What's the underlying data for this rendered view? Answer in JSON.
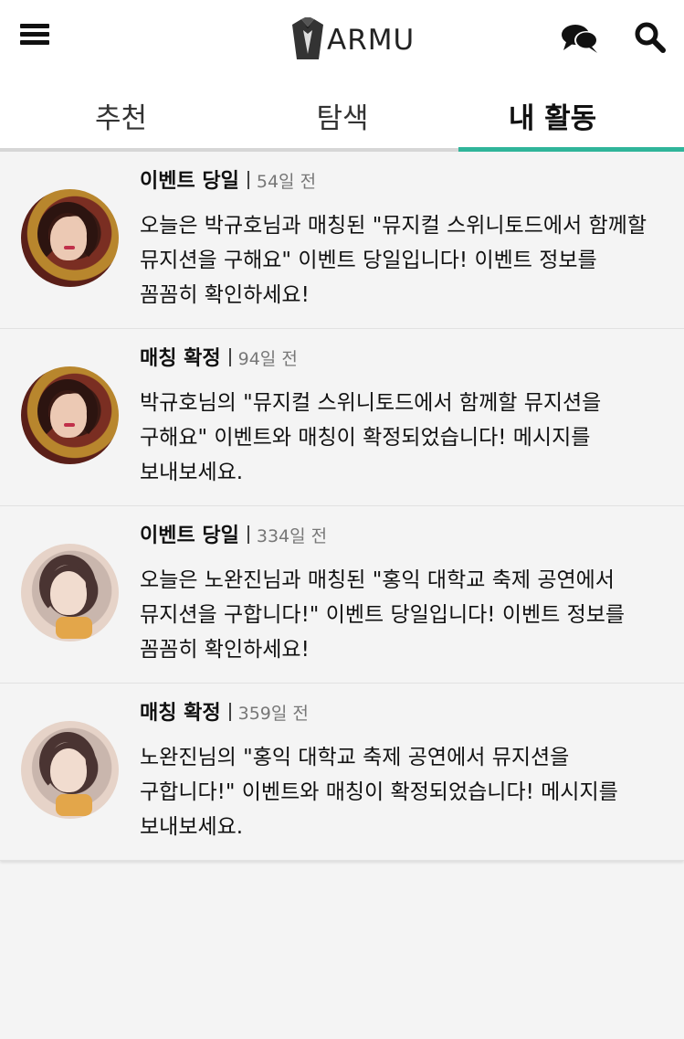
{
  "app": {
    "logo_text": "ARMU"
  },
  "icons": {
    "menu": "hamburger-menu-icon",
    "logo": "tuxedo-logo-icon",
    "chat": "chat-bubbles-icon",
    "search": "search-icon"
  },
  "tabs": [
    {
      "label": "추천",
      "active": false
    },
    {
      "label": "탐색",
      "active": false
    },
    {
      "label": "내 활동",
      "active": true
    }
  ],
  "colors": {
    "accent": "#2fb59a",
    "background": "#f4f4f4"
  },
  "notifications": [
    {
      "type": "이벤트 당일",
      "time": "54일 전",
      "message": "오늘은 박규호님과 매칭된 \"뮤지컬 스위니토드에서 함께할 뮤지션을 구해요\" 이벤트 당일입니다! 이벤트 정보를 꼼꼼히 확인하세요!",
      "avatar": "user-avatar-1"
    },
    {
      "type": "매칭 확정",
      "time": "94일 전",
      "message": "박규호님의 \"뮤지컬 스위니토드에서 함께할 뮤지션을 구해요\" 이벤트와 매칭이 확정되었습니다! 메시지를 보내보세요.",
      "avatar": "user-avatar-1"
    },
    {
      "type": "이벤트 당일",
      "time": "334일 전",
      "message": "오늘은 노완진님과 매칭된 \"홍익 대학교 축제 공연에서 뮤지션을 구합니다!\" 이벤트 당일입니다! 이벤트 정보를 꼼꼼히 확인하세요!",
      "avatar": "user-avatar-2"
    },
    {
      "type": "매칭 확정",
      "time": "359일 전",
      "message": "노완진님의 \"홍익 대학교 축제 공연에서 뮤지션을 구합니다!\" 이벤트와 매칭이 확정되었습니다! 메시지를 보내보세요.",
      "avatar": "user-avatar-2"
    }
  ]
}
